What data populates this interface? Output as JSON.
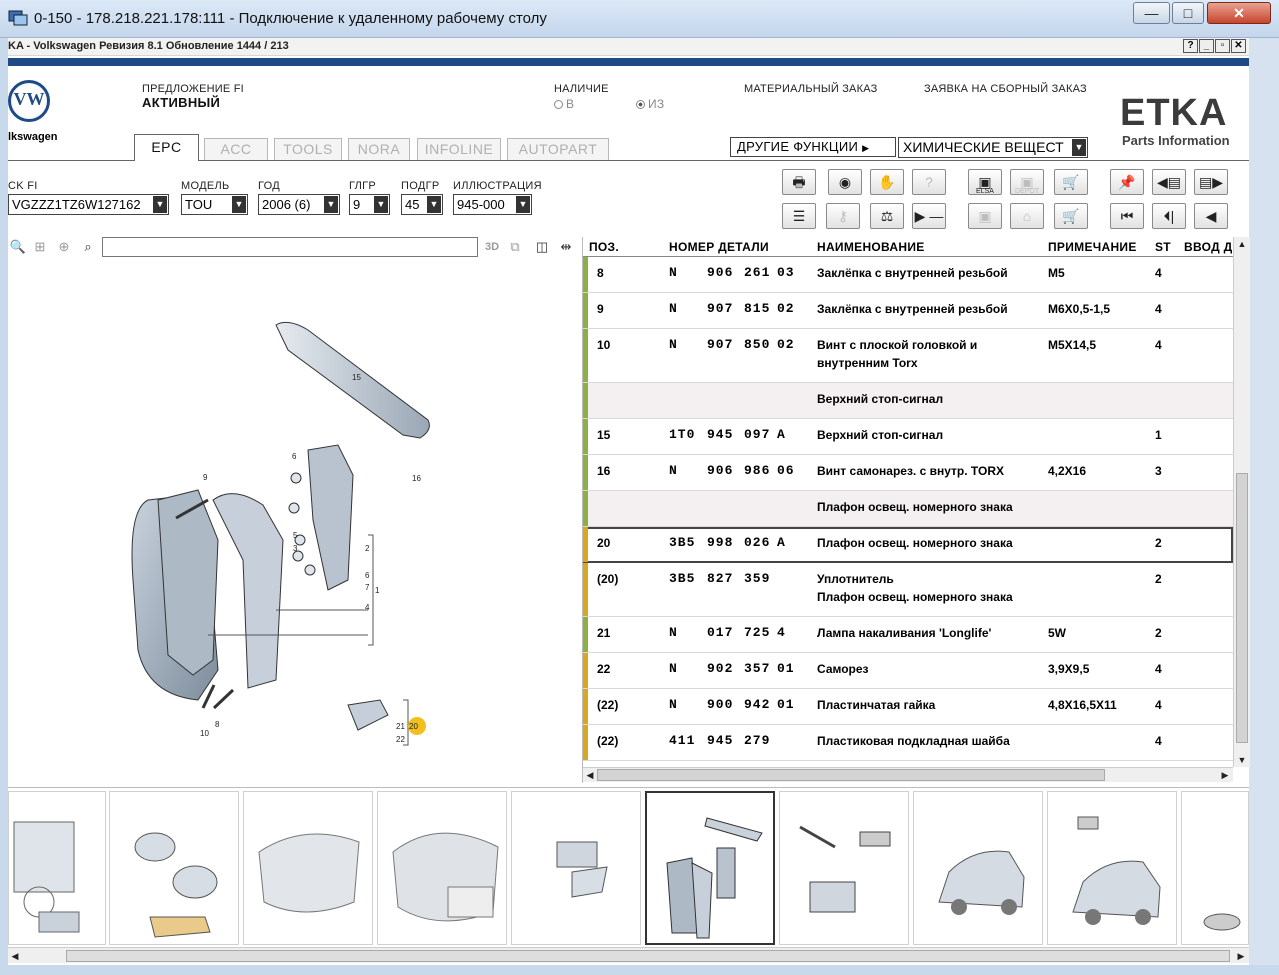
{
  "rdp": {
    "title": "0-150 - 178.218.221.178:111 - Подключение к удаленному рабочему столу",
    "btn_minimize": "—",
    "btn_maximize": "□",
    "btn_close": "✕"
  },
  "app": {
    "title": "KA - Volkswagen Ревизия 8.1 Обновление 1444 / 213",
    "btns": [
      "?",
      "_",
      "▫",
      "✕"
    ]
  },
  "header": {
    "logo_text": "VW",
    "brand": "lkswagen",
    "offer_label": "ПРЕДЛОЖЕНИЕ FI",
    "offer_value": "АКТИВНЫЙ",
    "availability_label": "НАЛИЧИЕ",
    "avail_in": "В",
    "avail_out": "ИЗ",
    "material_order": "МАТЕРИАЛЬНЫЙ ЗАКАЗ",
    "assembly_order": "ЗАЯВКА НА СБОРНЫЙ ЗАКАЗ",
    "etka": "ETKA",
    "etka_sub": "Parts Information"
  },
  "tabs": [
    "EPC",
    "ACC",
    "TOOLS",
    "NORA",
    "INFOLINE",
    "AUTOPART"
  ],
  "other_functions": "ДРУГИЕ ФУНКЦИИ",
  "chem_select": "ХИМИЧЕСКИЕ ВЕЩЕСТ",
  "selectors": {
    "vin_label": "CK FI",
    "vin_value": "VGZZZ1TZ6W127162",
    "model_label": "МОДЕЛЬ",
    "model_value": "TOU",
    "year_label": "ГОД",
    "year_value": "2006 (6)",
    "mg_label": "ГЛГР",
    "mg_value": "9",
    "sg_label": "ПОДГР",
    "sg_value": "45",
    "ill_label": "ИЛЛЮСТРАЦИЯ",
    "ill_value": "945-000"
  },
  "toolbar": {
    "elsa": "ELSA",
    "depot": "DEPOT"
  },
  "ill_toolbar": {
    "btn_3d": "3D"
  },
  "table": {
    "headers": [
      "ПОЗ.",
      "НОМЕР ДЕТАЛИ",
      "НАИМЕНОВАНИЕ",
      "ПРИМЕЧАНИЕ",
      "ST",
      "ВВОД Д"
    ],
    "rows": [
      {
        "pos": "8",
        "pre": "N",
        "a": "906",
        "b": "261",
        "c": "03",
        "d": "",
        "name": "Заклёпка с внутренней резьбой",
        "name2": "",
        "note": "M5",
        "qty": "4"
      },
      {
        "pos": "9",
        "pre": "N",
        "a": "907",
        "b": "815",
        "c": "02",
        "d": "",
        "name": "Заклёпка с внутренней резьбой",
        "name2": "",
        "note": "M6X0,5-1,5",
        "qty": "4"
      },
      {
        "pos": "10",
        "pre": "N",
        "a": "907",
        "b": "850",
        "c": "02",
        "d": "",
        "name": "Винт с плоской головкой и",
        "name2": "внутренним Torx",
        "note": "M5X14,5",
        "qty": "4"
      },
      {
        "pos": "",
        "pre": "",
        "a": "",
        "b": "",
        "c": "",
        "d": "",
        "name": "Верхний стоп-сигнал",
        "name2": "",
        "note": "",
        "qty": ""
      },
      {
        "pos": "15",
        "pre": "1T0",
        "a": "945",
        "b": "097",
        "c": "",
        "d": "A",
        "name": "Верхний стоп-сигнал",
        "name2": "",
        "note": "",
        "qty": "1"
      },
      {
        "pos": "16",
        "pre": "N",
        "a": "906",
        "b": "986",
        "c": "06",
        "d": "",
        "name": "Винт самонарез. с внутр. TORX",
        "name2": "",
        "note": "4,2X16",
        "qty": "3"
      },
      {
        "pos": "",
        "pre": "",
        "a": "",
        "b": "",
        "c": "",
        "d": "",
        "name": "Плафон освещ. номерного знака",
        "name2": "",
        "note": "",
        "qty": ""
      },
      {
        "pos": "20",
        "pre": "3B5",
        "a": "998",
        "b": "026",
        "c": "",
        "d": "A",
        "name": "Плафон освещ. номерного знака",
        "name2": "",
        "note": "",
        "qty": "2"
      },
      {
        "pos": "(20)",
        "pre": "3B5",
        "a": "827",
        "b": "359",
        "c": "",
        "d": "",
        "name": "Уплотнитель",
        "name2": "Плафон освещ. номерного знака",
        "note": "",
        "qty": "2"
      },
      {
        "pos": "21",
        "pre": "N",
        "a": "017",
        "b": "725",
        "c": "4",
        "d": "",
        "name": "Лампа накаливания 'Longlife'",
        "name2": "",
        "note": "5W",
        "qty": "2"
      },
      {
        "pos": "22",
        "pre": "N",
        "a": "902",
        "b": "357",
        "c": "01",
        "d": "",
        "name": "Саморез",
        "name2": "",
        "note": "3,9X9,5",
        "qty": "4"
      },
      {
        "pos": "(22)",
        "pre": "N",
        "a": "900",
        "b": "942",
        "c": "01",
        "d": "",
        "name": "Пластинчатая гайка",
        "name2": "",
        "note": "4,8X16,5X11",
        "qty": "4"
      },
      {
        "pos": "(22)",
        "pre": "411",
        "a": "945",
        "b": "279",
        "c": "",
        "d": "",
        "name": "Пластиковая подкладная шайба",
        "name2": "",
        "note": "",
        "qty": "4"
      }
    ]
  },
  "illustration": {
    "labels": [
      "15",
      "16",
      "6",
      "9",
      "5",
      "3",
      "2",
      "6",
      "7",
      "1",
      "4",
      "10",
      "8",
      "21",
      "22",
      "20"
    ]
  },
  "colors": {
    "brand_blue": "#1f4a86",
    "marker_green": "#8fae45",
    "marker_yellow": "#d9a820",
    "callout_yellow": "#f2c01e"
  }
}
